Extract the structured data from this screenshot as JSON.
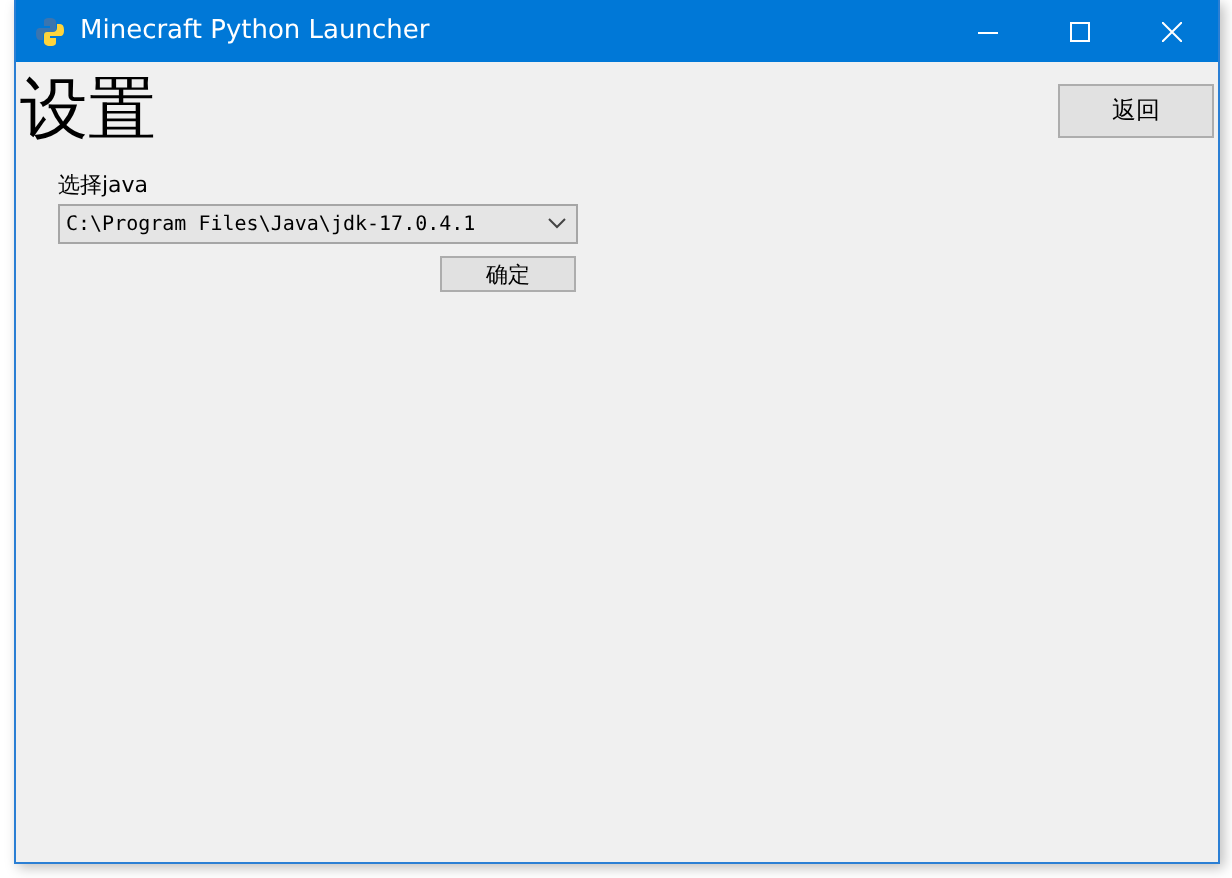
{
  "window": {
    "title": "Minecraft Python Launcher"
  },
  "heading": "设置",
  "back_button": "返回",
  "java": {
    "label": "选择java",
    "value": "C:\\Program Files\\Java\\jdk-17.0.4.1"
  },
  "confirm_button": "确定"
}
